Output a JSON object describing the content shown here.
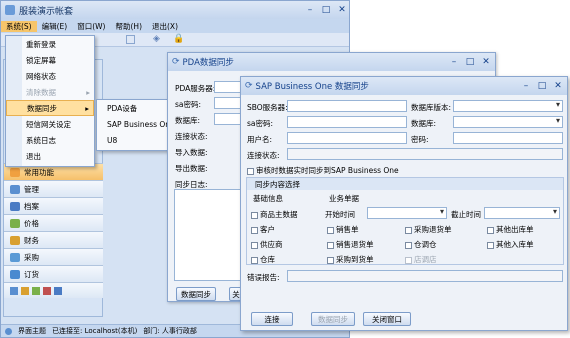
{
  "main": {
    "title": "服装演示帐套",
    "menus": [
      "系统(S)",
      "编辑(E)",
      "窗口(W)",
      "帮助(H)",
      "退出(X)"
    ]
  },
  "system_menu": {
    "items": [
      {
        "label": "重新登录",
        "enabled": true
      },
      {
        "label": "锁定屏幕",
        "enabled": true
      },
      {
        "label": "网络状态",
        "enabled": true
      },
      {
        "label": "清除数据",
        "enabled": false
      },
      {
        "label": "数据同步",
        "enabled": true
      },
      {
        "label": "短信网关设定",
        "enabled": true
      },
      {
        "label": "系统日志",
        "enabled": true
      },
      {
        "label": "退出",
        "enabled": true
      }
    ],
    "submenu": [
      "PDA设备",
      "SAP Business One",
      "U8"
    ]
  },
  "nav": {
    "items": [
      {
        "label": "常用功能",
        "color": "#f0a040"
      },
      {
        "label": "管理",
        "color": "#5a8fd0"
      },
      {
        "label": "档案",
        "color": "#4a7bc4"
      },
      {
        "label": "价格",
        "color": "#7ab04a"
      },
      {
        "label": "财务",
        "color": "#d9a030"
      },
      {
        "label": "采购",
        "color": "#5a9ad6"
      },
      {
        "label": "订货",
        "color": "#4a8ad0"
      }
    ]
  },
  "statusbar": {
    "theme": "界面主题",
    "connection": "已连接至: Localhost(本机)",
    "department": "部门: 人事行政部"
  },
  "pda": {
    "title": "PDA数据同步",
    "labels": [
      "PDA服务器:",
      "sa密码:",
      "数据库:",
      "连接状态:",
      "导入数据:",
      "导出数据:",
      "同步日志:"
    ],
    "button_sync": "数据同步",
    "button_close": "关"
  },
  "sap": {
    "title": "SAP Business One 数据同步",
    "sbo_server": "SBO服务器:",
    "db_version": "数据库版本:",
    "sa_password": "sa密码:",
    "database": "数据库:",
    "username": "用户名:",
    "password": "密码:",
    "conn_status": "连接状态:",
    "realtime_sync": "审核时数据实时同步到SAP Business One",
    "content_header": "同步内容选择",
    "basic_info": "基础信息",
    "business_docs": "业务单据",
    "start_time": "开始时间",
    "end_time": "截止时间",
    "basic_items": [
      "商品主数据",
      "客户",
      "供应商",
      "仓库"
    ],
    "doc_col1": [
      "销售单",
      "销售退货单",
      "采购到货单"
    ],
    "doc_col2": [
      "采购退货单",
      "仓调仓",
      "店调店"
    ],
    "doc_col3": [
      "其他出库单",
      "其他入库单"
    ],
    "error_report": "错误报告:",
    "btn_connect": "连接",
    "btn_sync": "数据同步",
    "btn_close": "关闭窗口"
  }
}
